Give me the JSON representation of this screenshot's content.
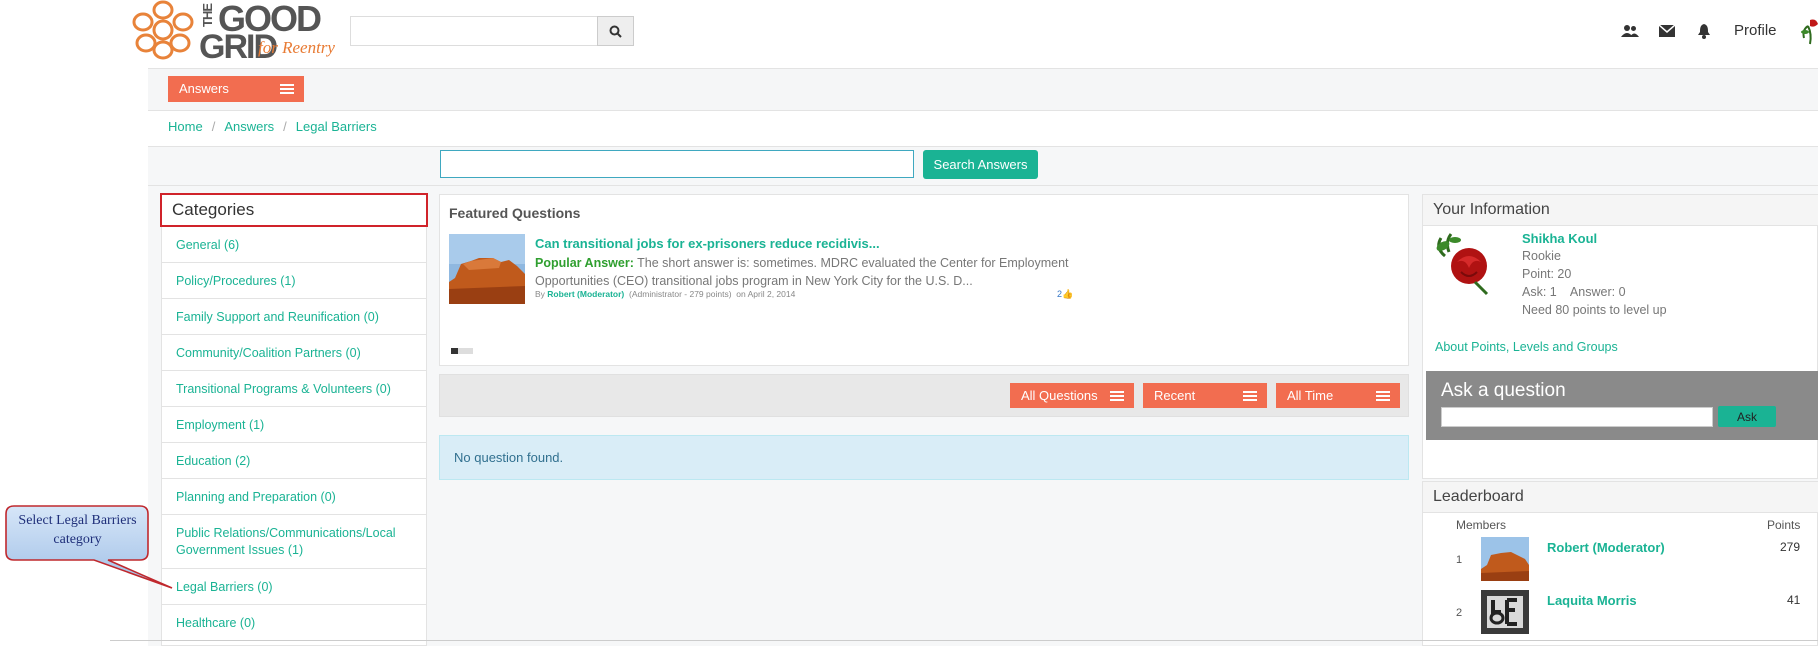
{
  "logo": {
    "the": "THE",
    "good": "GOOD",
    "grid": "GRID",
    "tagline": "for Reentry"
  },
  "header": {
    "search_placeholder": "",
    "icons": [
      "search-icon",
      "users-icon",
      "envelope-icon",
      "bell-icon"
    ],
    "profile_label": "Profile"
  },
  "answers_menu": {
    "label": "Answers"
  },
  "breadcrumb": {
    "items": [
      "Home",
      "Answers",
      "Legal Barriers"
    ]
  },
  "search_answers": {
    "placeholder": "",
    "button": "Search Answers"
  },
  "categories": {
    "title": "Categories",
    "items": [
      "General (6)",
      "Policy/Procedures (1)",
      "Family Support and Reunification (0)",
      "Community/Coalition Partners (0)",
      "Transitional Programs & Volunteers (0)",
      "Employment (1)",
      "Education (2)",
      "Planning and Preparation (0)",
      "Public Relations/Communications/Local Government Issues (1)",
      "Legal Barriers (0)",
      "Healthcare (0)"
    ]
  },
  "featured": {
    "title": "Featured Questions",
    "question": "Can transitional jobs for ex-prisoners reduce recidivis...",
    "popular_label": "Popular Answer:",
    "popular_text": "The short answer is: sometimes. MDRC evaluated the Center for Employment Opportunities (CEO) transitional jobs program in New York City for the U.S. D...",
    "by": "By",
    "author": "Robert (Moderator)",
    "author_meta": "(Administrator - 279 points)",
    "date": "on April 2, 2014",
    "likes": "2"
  },
  "filters": {
    "all_questions": "All Questions",
    "recent": "Recent",
    "all_time": "All Time"
  },
  "no_questions": "No question found.",
  "your_info": {
    "title": "Your Information",
    "name": "Shikha Koul",
    "rank": "Rookie",
    "points": "Point: 20",
    "ask_answer": "Ask: 1    Answer: 0",
    "need": "Need 80 points to level up",
    "about_link": "About Points, Levels and Groups"
  },
  "ask": {
    "title": "Ask a question",
    "button": "Ask"
  },
  "leaderboard": {
    "title": "Leaderboard",
    "col_members": "Members",
    "col_points": "Points",
    "rows": [
      {
        "rank": "1",
        "name": "Robert (Moderator)",
        "points": "279"
      },
      {
        "rank": "2",
        "name": "Laquita Morris",
        "points": "41"
      }
    ]
  },
  "callout": {
    "text": "Select Legal Barriers category"
  },
  "colors": {
    "accent": "#1ab394",
    "orange": "#f26d50",
    "highlight": "#d0232a",
    "callout": "#a9c6ea"
  }
}
